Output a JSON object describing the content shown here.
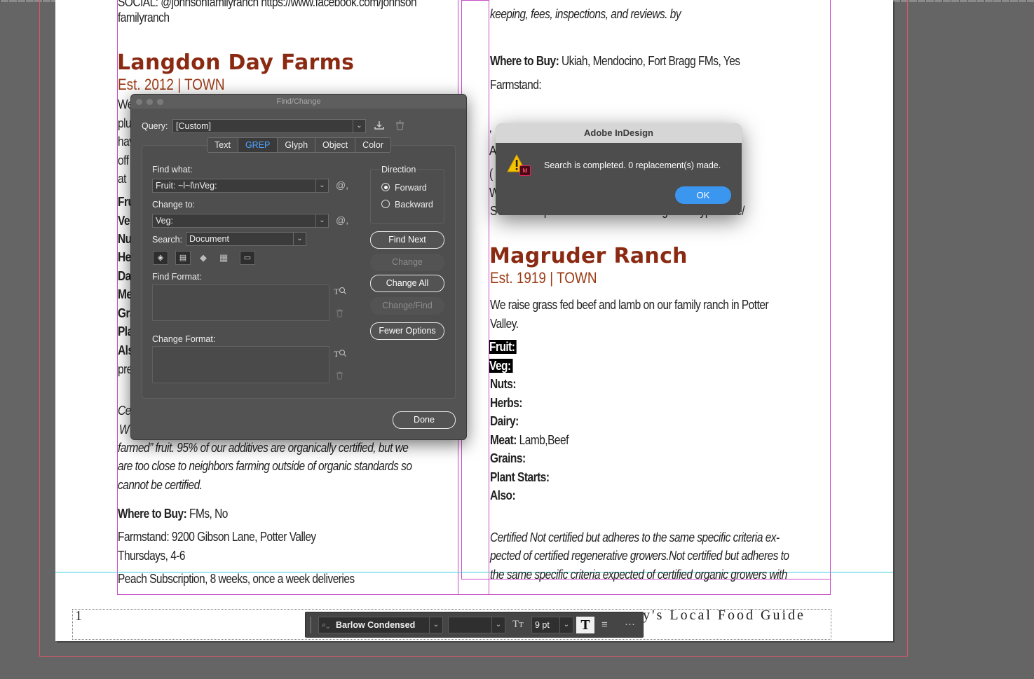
{
  "left_column": {
    "top_partial": "SOCIAL: @johnsonfamilyranch https://www.facebook.com/johnson",
    "top_partial2": "familyranch",
    "farm_title": "Langdon Day Farms",
    "farm_est": "Est. 2012 | TOWN",
    "clipped_lines": [
      "We",
      "plu",
      "hav",
      "off",
      "at"
    ],
    "clipped_bold": [
      "Fru",
      "Ve",
      "Nu",
      "He",
      "Da",
      "Me",
      "Gra",
      "Pla",
      "Als"
    ],
    "clipped_pre": "pre",
    "clipped_italic1": "Ce",
    "clipped_italic2": "W",
    "italic_line1": "farmed” fruit. 95% of our additives are organically certified, but we",
    "italic_line2": "are too close to neighbors farming outside of organic standards so",
    "italic_line3": "cannot be certified.",
    "where_label": "Where to Buy:",
    "where_value": "  FMs,  No",
    "farmstand": "Farmstand: 9200 Gibson Lane, Potter Valley",
    "hours": "Thursdays, 4-6",
    "subscription": "Peach Subscription, 8 weeks, once a week deliveries"
  },
  "right_column": {
    "top_italic": "keeping, fees, inspections, and reviews. by",
    "where_label": "Where to Buy:",
    "where_value": " Ukiah, Mendocino, Fort Bragg FMs,  Yes",
    "farmstand_label": "Farmstand:",
    "clipped_quote": "‚",
    "clipped_a": "A",
    "clipped_paren": "( ",
    "clipped_w": "W",
    "social_line": "SOCIAL: https://www.facebook.com/reganfamilyproduce/",
    "farm_title": "Magruder Ranch",
    "farm_est": "Est. 1919 | TOWN",
    "desc_line1": "We raise grass fed beef and lamb on our family ranch in Potter",
    "desc_line2": "Valley.",
    "fruit_label": "Fruit: ",
    "veg_label": "Veg:",
    "nuts_label": "Nuts:",
    "herbs_label": "Herbs:",
    "dairy_label": "Dairy:",
    "meat_label": "Meat:",
    "meat_value": " Lamb,Beef",
    "grains_label": "Grains:",
    "plant_label": "Plant Starts:",
    "also_label": "Also:",
    "cert_line1": "Certified Not certified but adheres to the same specific criteria ex-",
    "cert_line2": "pected of certified regenerative growers.Not certified but adheres to",
    "cert_line3": "the same specific criteria expected of certified organic growers with"
  },
  "footer": {
    "page_number": "1",
    "guide_title": "Mendocino County's Local Food Guide",
    "guide_visible": "y's  Local  Food  Guide"
  },
  "find_change": {
    "title": "Find/Change",
    "query_label": "Query:",
    "query_value": "[Custom]",
    "tabs": [
      "Text",
      "GREP",
      "Glyph",
      "Object",
      "Color"
    ],
    "active_tab": "GREP",
    "find_what_label": "Find what:",
    "find_what_value": "Fruit: ~l~l\\nVeg:",
    "change_to_label": "Change to:",
    "change_to_value": "Veg:",
    "search_label": "Search:",
    "search_value": "Document",
    "find_format_label": "Find Format:",
    "change_format_label": "Change Format:",
    "direction_label": "Direction",
    "forward_label": "Forward",
    "backward_label": "Backward",
    "direction_selected": "Forward",
    "buttons": {
      "find_next": "Find Next",
      "change": "Change",
      "change_all": "Change All",
      "change_find": "Change/Find",
      "fewer_options": "Fewer Options",
      "done": "Done"
    }
  },
  "alert": {
    "title": "Adobe InDesign",
    "message": "Search is completed.  0 replacement(s) made.",
    "ok": "OK",
    "icon_badge": "Id"
  },
  "control_bar": {
    "font_family": "Barlow Condensed",
    "font_style": "",
    "font_size": "9 pt"
  },
  "colors": {
    "farm_title": "#8b2a12",
    "ok_button": "#3b96f0",
    "active_tab": "#4da3ff",
    "margin_guide": "#c84cc8",
    "bleed_guide": "#e0556c",
    "baseline_guide": "#3cd0e0"
  }
}
